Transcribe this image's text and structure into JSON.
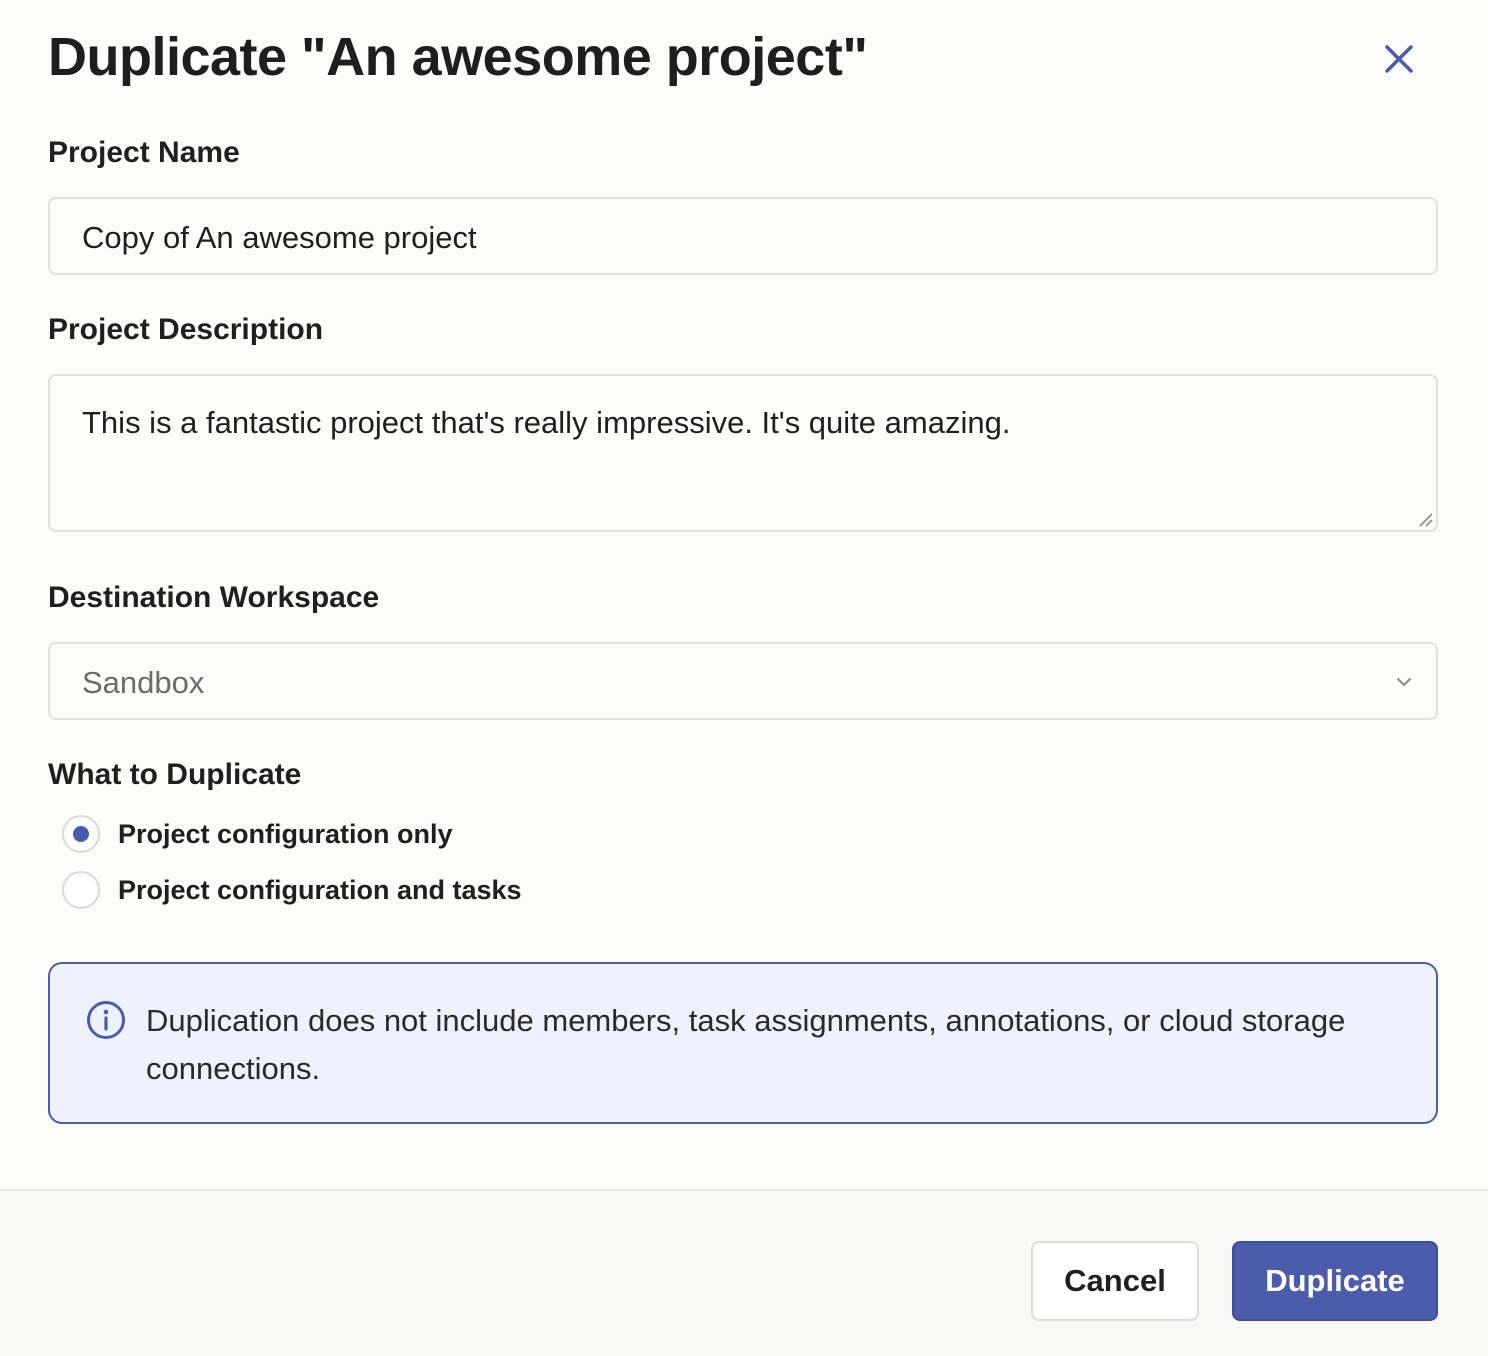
{
  "dialog": {
    "title": "Duplicate \"An awesome project\""
  },
  "fields": {
    "project_name": {
      "label": "Project Name",
      "value": "Copy of An awesome project"
    },
    "project_description": {
      "label": "Project Description",
      "value": "This is a fantastic project that's really impressive. It's quite amazing."
    },
    "destination_workspace": {
      "label": "Destination Workspace",
      "selected": "Sandbox"
    }
  },
  "what_to_duplicate": {
    "label": "What to Duplicate",
    "options": [
      {
        "label": "Project configuration only",
        "checked": true
      },
      {
        "label": "Project configuration and tasks",
        "checked": false
      }
    ]
  },
  "info": {
    "text": "Duplication does not include members, task assignments, annotations, or cloud storage connections."
  },
  "footer": {
    "cancel_label": "Cancel",
    "duplicate_label": "Duplicate"
  },
  "icons": {
    "close": "close-icon",
    "chevron": "chevron-down-icon",
    "info": "info-icon"
  },
  "colors": {
    "accent": "#4c5cad",
    "info_background": "#eff2fd",
    "border": "#e1e0dd"
  }
}
